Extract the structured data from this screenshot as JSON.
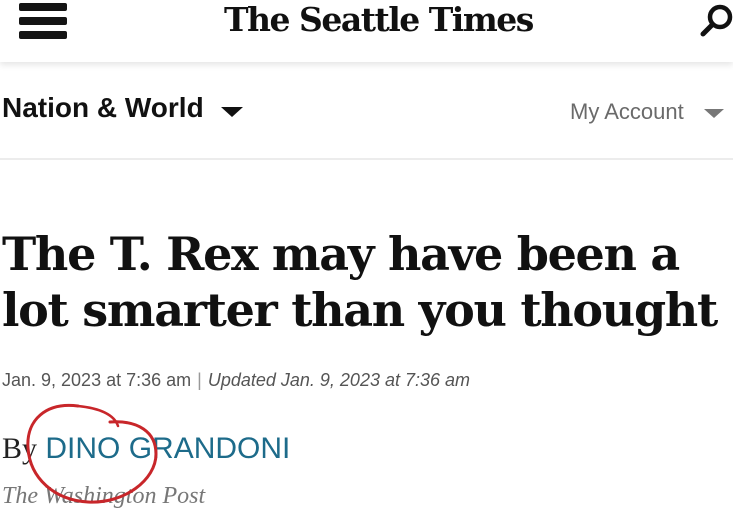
{
  "header": {
    "brand": "The Seattle Times",
    "menu_icon": "hamburger-menu-icon",
    "search_icon": "search-icon"
  },
  "nav": {
    "section": "Nation & World",
    "account": "My Account"
  },
  "article": {
    "headline": "The T. Rex may have been a lot smarter than you thought",
    "published": "Jan. 9, 2023 at 7:36 am",
    "separator": "|",
    "updated": "Updated Jan. 9, 2023 at 7:36 am",
    "by": "By",
    "author": "DINO GRANDONI",
    "source": "The Washington Post"
  },
  "colors": {
    "author_link": "#1d6b8a",
    "annotation": "#c8262a"
  }
}
